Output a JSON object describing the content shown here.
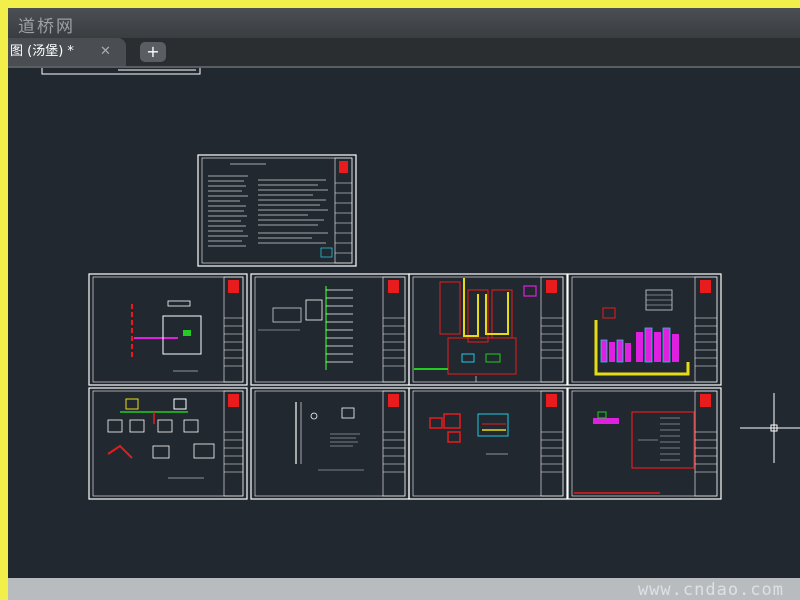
{
  "app": {
    "watermark_title": "道桥网"
  },
  "tabs": [
    {
      "label": "图 (汤堡) *",
      "close_icon": "close-icon"
    }
  ],
  "new_tab": {
    "label": "+"
  },
  "canvas": {
    "background": "#212830",
    "sheet_count": 9,
    "crosshair_icon": "crosshair-cursor-icon"
  },
  "status": {
    "site_watermark": "www.cndao.com"
  },
  "colors": {
    "accent_yellow": "#f2ee4a",
    "sheet_border": "#ffffff",
    "title_block_red": "#e81c1c",
    "pipe_magenta": "#e020e0",
    "pipe_green": "#22cc22",
    "pipe_yellow": "#e6dc16",
    "pipe_cyan": "#20c8e0"
  }
}
